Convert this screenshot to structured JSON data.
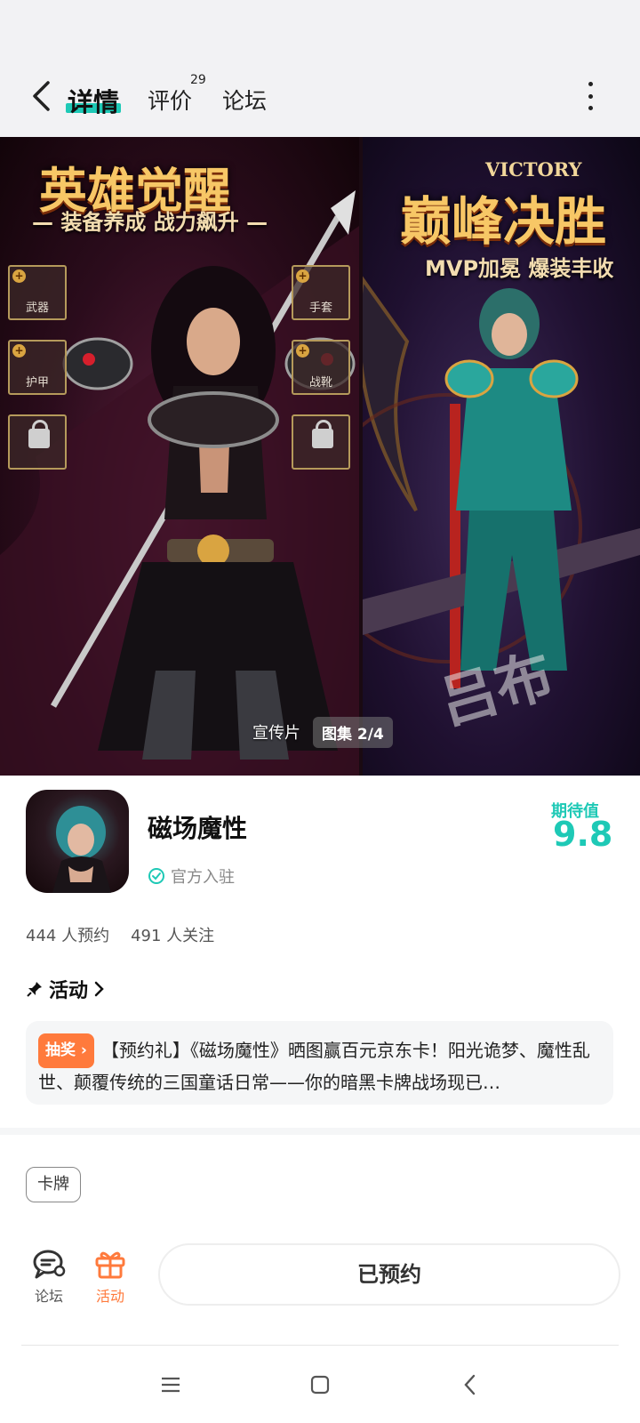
{
  "header": {
    "tabs": [
      {
        "label": "详情",
        "active": true
      },
      {
        "label": "评价",
        "count": "29"
      },
      {
        "label": "论坛"
      }
    ]
  },
  "gallery": {
    "image1": {
      "headline": "英雄觉醒",
      "subheadline": "— 装备养成 战力飙升 —",
      "slots": [
        "武器",
        "手套",
        "护甲",
        "战靴"
      ]
    },
    "image2": {
      "victory": "VICTORY",
      "headline": "巅峰决胜",
      "subheadline": "MVP加冕 爆装丰收",
      "watermark": "吕布"
    },
    "video_label": "宣传片",
    "album_label": "图集 2/4"
  },
  "app": {
    "name": "磁场魔性",
    "official_label": "官方入驻",
    "anticipation_label": "期待值",
    "anticipation_score": "9.8",
    "reservations": "444 人预约",
    "followers": "491 人关注"
  },
  "activity": {
    "heading": "活动",
    "badge": "抽奖",
    "text": "【预约礼】《磁场魔性》晒图赢百元京东卡！阳光诡梦、魔性乱世、颠覆传统的三国童话日常——你的暗黑卡牌战场现已…"
  },
  "tags": [
    "卡牌"
  ],
  "bottom_bar": {
    "forum_label": "论坛",
    "event_label": "活动",
    "reserve_label": "已预约"
  },
  "colors": {
    "accent": "#1ec9b6",
    "orange": "#ff7a3c"
  }
}
